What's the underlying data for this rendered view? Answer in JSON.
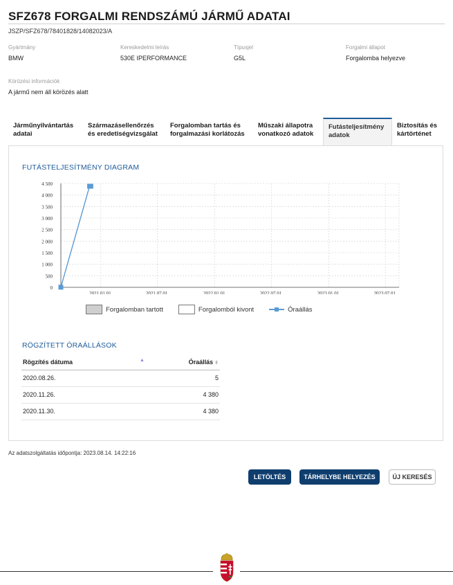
{
  "header": {
    "title": "SFZ678 FORGALMI RENDSZÁMÚ JÁRMŰ ADATAI",
    "reference": "JSZP/SFZ678/78401828/14082023/A"
  },
  "vehicle": {
    "manufacturer_label": "Gyártmány",
    "manufacturer_value": "BMW",
    "trade_label": "Kereskedelmi leírás",
    "trade_value": "530E IPERFORMANCE",
    "type_label": "Típusjel",
    "type_value": "G5L",
    "status_label": "Forgalmi állapot",
    "status_value": "Forgalomba helyezve",
    "wanted_label": "Körözési információk",
    "wanted_value": "A jármű nem áll körözés alatt"
  },
  "tabs": [
    {
      "line1": "Járműnyilvántartás",
      "line2": "adatai"
    },
    {
      "line1": "Származásellenőrzés",
      "line2": "és eredetiségvizsgálat"
    },
    {
      "line1": "Forgalomban tartás és",
      "line2": "forgalmazási korlátozás"
    },
    {
      "line1": "Műszaki állapotra",
      "line2": "vonatkozó adatok"
    },
    {
      "line1": "Futásteljesítmény",
      "line2": "adatok"
    },
    {
      "line1": "Biztosítás és",
      "line2": "kártörténet"
    }
  ],
  "chart_section": {
    "title": "FUTÁSTELJESÍTMÉNY DIAGRAM",
    "legend": {
      "in_traffic": "Forgalomban tartott",
      "withdrawn": "Forgalomból kivont",
      "odometer": "Óraállás"
    }
  },
  "chart_data": {
    "type": "line",
    "x_tick_labels": [
      "2021.01.01.",
      "2021.07.01.",
      "2022.01.01.",
      "2022.07.01.",
      "2023.01.01.",
      "2023.07.01."
    ],
    "y_tick_labels": [
      "0",
      "500",
      "1 000",
      "1 500",
      "2 000",
      "2 500",
      "3 000",
      "3 500",
      "4 000",
      "4 500"
    ],
    "ylim": [
      0,
      4500
    ],
    "xlim": [
      "2020.08.26.",
      "2023.08.14."
    ],
    "grid": true,
    "legend_position": "bottom",
    "series": [
      {
        "name": "Óraállás",
        "color": "#5b9bd5",
        "points": [
          {
            "x": "2020.08.26.",
            "y": 5
          },
          {
            "x": "2020.11.26.",
            "y": 4380
          },
          {
            "x": "2020.11.30.",
            "y": 4380
          }
        ]
      }
    ]
  },
  "readings": {
    "title": "RÖGZÍTETT ÓRAÁLLÁSOK",
    "col_date": "Rögzítés dátuma",
    "col_odometer": "Óraállás",
    "rows": [
      {
        "date": "2020.08.26.",
        "value": "5"
      },
      {
        "date": "2020.11.26.",
        "value": "4 380"
      },
      {
        "date": "2020.11.30.",
        "value": "4 380"
      }
    ]
  },
  "footer": {
    "timestamp": "Az adatszolgáltatás időpontja: 2023.08.14. 14:22:16",
    "download": "LETÖLTÉS",
    "store": "TÁRHELYBE HELYEZÉS",
    "new_search": "ÚJ KERESÉS"
  },
  "colors": {
    "accent": "#1f5c99",
    "button_primary": "#0f3e6e",
    "series_line": "#5b9bd5"
  }
}
